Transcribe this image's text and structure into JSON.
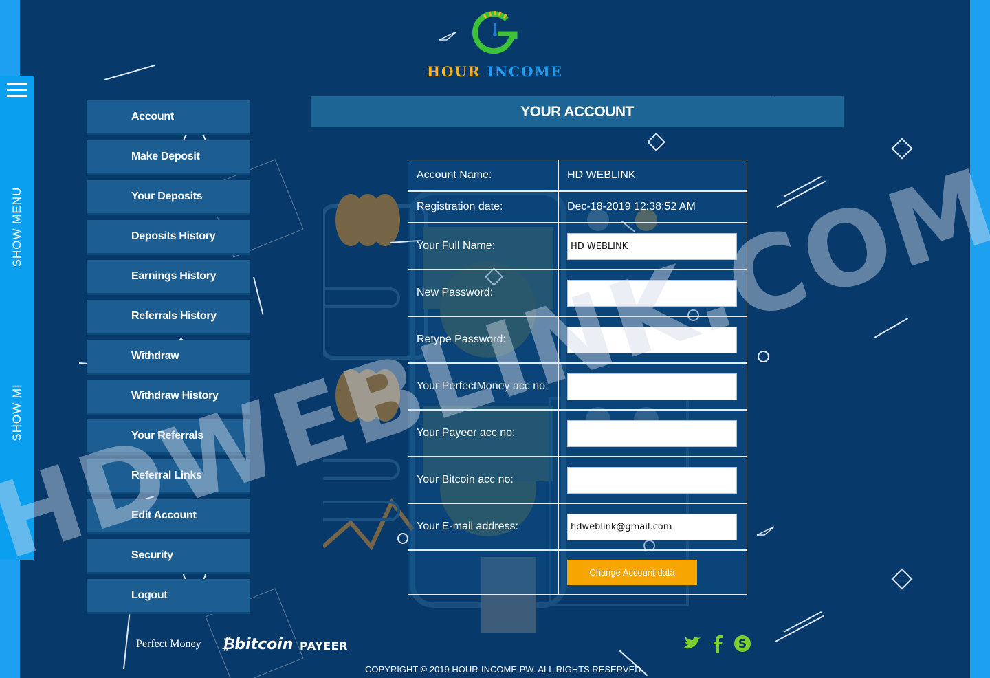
{
  "side_menu": {
    "label_primary": "SHOW MENU",
    "label_secondary": "SHOW MI"
  },
  "logo": {
    "word1": "HOUR",
    "word2": "INCOME"
  },
  "sidebar": {
    "items": [
      {
        "label": "Account"
      },
      {
        "label": "Make Deposit"
      },
      {
        "label": "Your Deposits"
      },
      {
        "label": "Deposits History"
      },
      {
        "label": "Earnings History"
      },
      {
        "label": "Referrals History"
      },
      {
        "label": "Withdraw"
      },
      {
        "label": "Withdraw History"
      },
      {
        "label": "Your Referrals"
      },
      {
        "label": "Referral Links"
      },
      {
        "label": "Edit Account"
      },
      {
        "label": "Security"
      },
      {
        "label": "Logout"
      }
    ]
  },
  "page_title": "YOUR ACCOUNT",
  "form": {
    "account_name_label": "Account Name:",
    "account_name_value": "HD WEBLINK",
    "registration_label": "Registration date:",
    "registration_value": "Dec-18-2019 12:38:52 AM",
    "full_name_label": "Your Full Name:",
    "full_name_value": "HD WEBLINK",
    "new_password_label": "New Password:",
    "new_password_value": "",
    "retype_password_label": "Retype Password:",
    "retype_password_value": "",
    "perfectmoney_label": "Your PerfectMoney acc no:",
    "perfectmoney_value": "",
    "payeer_label": "Your Payeer acc no:",
    "payeer_value": "",
    "bitcoin_label": "Your Bitcoin acc no:",
    "bitcoin_value": "",
    "email_label": "Your E-mail address:",
    "email_value": "hdweblink@gmail.com",
    "submit_label": "Change Account data"
  },
  "watermark": "HDWEBLINK.COM",
  "footer": {
    "payment_perfectmoney": "Perfect Money",
    "payment_bitcoin": "bitcoin",
    "payment_payeer": "PAYEER",
    "copyright": "COPYRIGHT © 2019 HOUR-INCOME.PW. ALL RIGHTS RESERVED",
    "social": [
      "twitter-icon",
      "facebook-icon",
      "skype-icon"
    ]
  },
  "colors": {
    "background": "#07396a",
    "accent_blue": "#1ea0f0",
    "button_orange": "#f7a500",
    "logo_green": "#3ec23a",
    "logo_gold": "#f3b220"
  }
}
